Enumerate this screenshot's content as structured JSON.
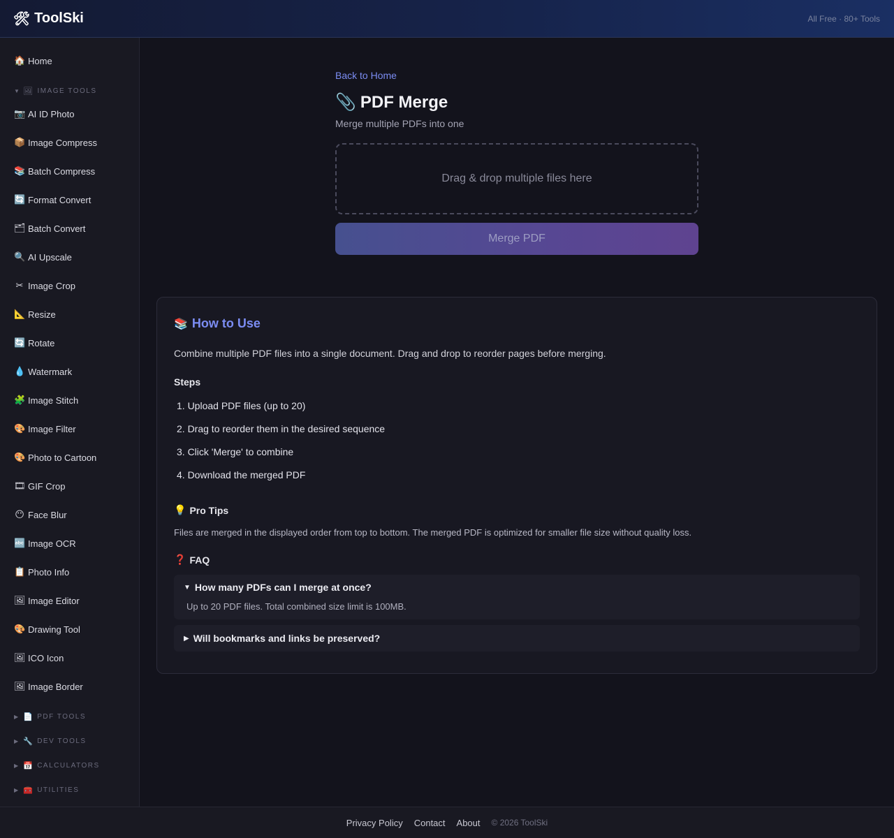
{
  "header": {
    "logo_icon": "🛠",
    "logo_text": "ToolSki",
    "tagline": "All Free · 80+ Tools"
  },
  "sidebar": {
    "home": {
      "icon": "🏠",
      "label": "Home"
    },
    "image_section": {
      "caret": "▼",
      "icon": "🖼",
      "label": "IMAGE TOOLS"
    },
    "items": [
      {
        "icon": "📷",
        "label": "AI ID Photo"
      },
      {
        "icon": "📦",
        "label": "Image Compress"
      },
      {
        "icon": "📚",
        "label": "Batch Compress"
      },
      {
        "icon": "🔄",
        "label": "Format Convert"
      },
      {
        "icon": "🗂",
        "label": "Batch Convert"
      },
      {
        "icon": "🔍",
        "label": "AI Upscale"
      },
      {
        "icon": "✂",
        "label": "Image Crop"
      },
      {
        "icon": "📐",
        "label": "Resize"
      },
      {
        "icon": "🔄",
        "label": "Rotate"
      },
      {
        "icon": "💧",
        "label": "Watermark"
      },
      {
        "icon": "🧩",
        "label": "Image Stitch"
      },
      {
        "icon": "🎨",
        "label": "Image Filter"
      },
      {
        "icon": "🎨",
        "label": "Photo to Cartoon"
      },
      {
        "icon": "🎞",
        "label": "GIF Crop"
      },
      {
        "icon": "😶",
        "label": "Face Blur"
      },
      {
        "icon": "🔤",
        "label": "Image OCR"
      },
      {
        "icon": "📋",
        "label": "Photo Info"
      },
      {
        "icon": "🖼",
        "label": "Image Editor"
      },
      {
        "icon": "🎨",
        "label": "Drawing Tool"
      },
      {
        "icon": "🖼",
        "label": "ICO Icon"
      },
      {
        "icon": "🖼",
        "label": "Image Border"
      }
    ],
    "collapsed_sections": [
      {
        "caret": "▶",
        "icon": "📄",
        "label": "PDF TOOLS"
      },
      {
        "caret": "▶",
        "icon": "🔧",
        "label": "DEV TOOLS"
      },
      {
        "caret": "▶",
        "icon": "📅",
        "label": "CALCULATORS"
      },
      {
        "caret": "▶",
        "icon": "🧰",
        "label": "UTILITIES"
      }
    ]
  },
  "main": {
    "back_link": "Back to Home",
    "title_icon": "📎",
    "title": "PDF Merge",
    "subtitle": "Merge multiple PDFs into one",
    "dropzone_text": "Drag & drop multiple files here",
    "merge_button": "Merge PDF"
  },
  "howto": {
    "title_icon": "📚",
    "title": "How to Use",
    "description": "Combine multiple PDF files into a single document. Drag and drop to reorder pages before merging.",
    "steps_title": "Steps",
    "steps": [
      "1. Upload PDF files (up to 20)",
      "2. Drag to reorder them in the desired sequence",
      "3. Click 'Merge' to combine",
      "4. Download the merged PDF"
    ],
    "tips_icon": "💡",
    "tips_title": "Pro Tips",
    "tips_text": "Files are merged in the displayed order from top to bottom. The merged PDF is optimized for smaller file size without quality loss.",
    "faq_icon": "❓",
    "faq_title": "FAQ",
    "faq": [
      {
        "marker": "▼",
        "question": "How many PDFs can I merge at once?",
        "answer": "Up to 20 PDF files. Total combined size limit is 100MB."
      },
      {
        "marker": "▶",
        "question": "Will bookmarks and links be preserved?"
      }
    ]
  },
  "footer": {
    "links": [
      "Privacy Policy",
      "Contact",
      "About"
    ],
    "copyright": "© 2026 ToolSki"
  }
}
